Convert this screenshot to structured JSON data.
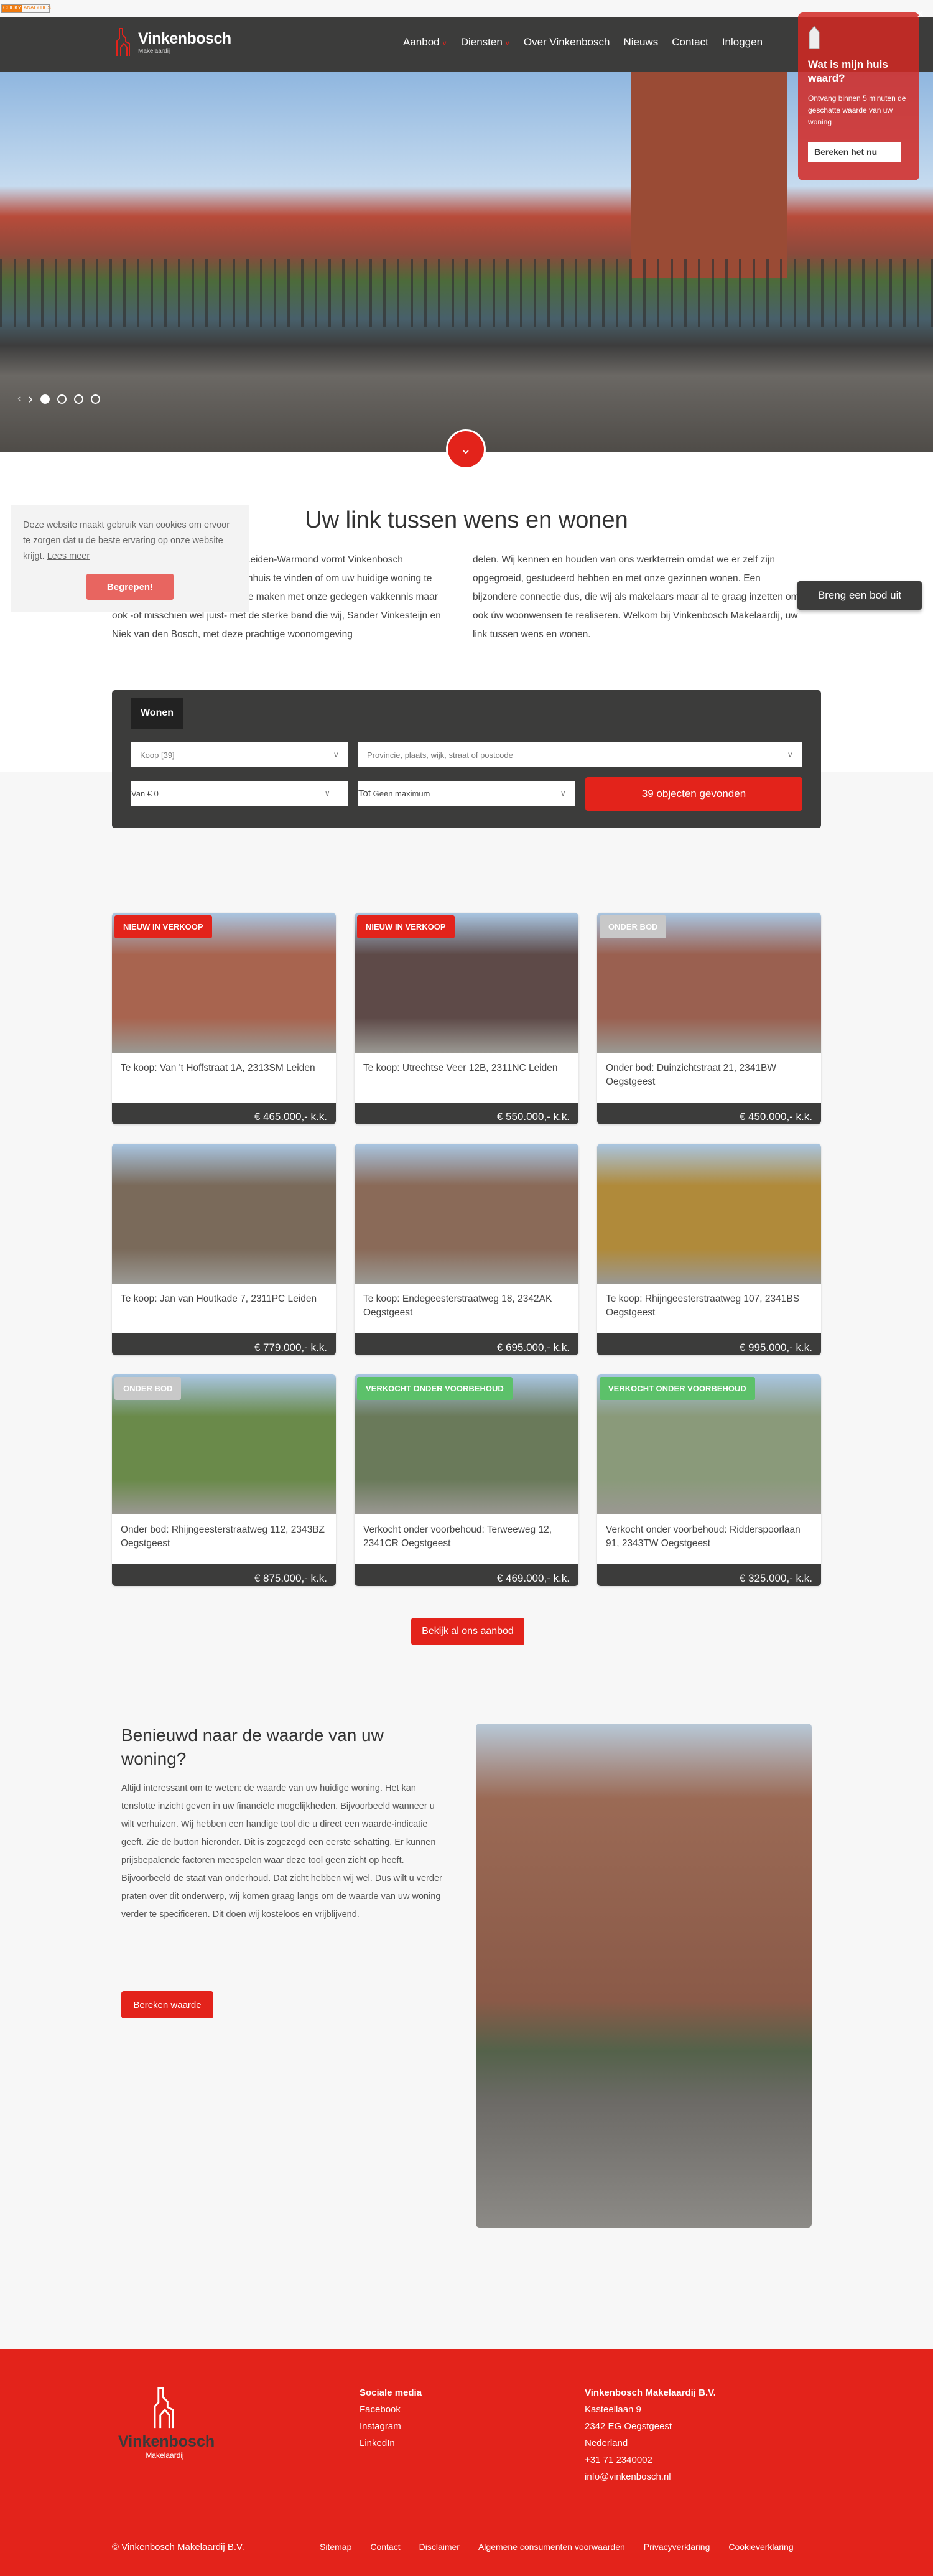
{
  "topbar": {
    "analytics_badge": [
      "CLICKY",
      "ANALYTICS"
    ]
  },
  "header": {
    "logo_name": "Vinkenbosch",
    "logo_sub": "Makelaardij",
    "nav": [
      {
        "label": "Aanbod",
        "dropdown": true
      },
      {
        "label": "Diensten",
        "dropdown": true
      },
      {
        "label": "Over Vinkenbosch"
      },
      {
        "label": "Nieuws"
      },
      {
        "label": "Contact"
      },
      {
        "label": "Inloggen"
      }
    ]
  },
  "popup": {
    "title": "Wat is mijn huis waard?",
    "text": "Ontvang binnen 5 minuten de geschatte waarde van uw woning",
    "button": "Bereken het nu",
    "close": "X"
  },
  "hero": {
    "slides": 4,
    "active_slide": 1
  },
  "intro": {
    "title": "Uw link tussen wens en wonen",
    "col1": "Binnen het gebied Oegstgeest-Leiden-Warmond vormt Vinkenbosch Makelaardij dé link om uw droomhuis te vinden of om uw huidige woning te verkopen. Dat heeft niet alleen te maken met onze gedegen vakkennis maar ook -of misschien wel juist- met de sterke band die wij, Sander Vinkesteijn en Niek van den Bosch, met deze prachtige woonomgeving",
    "col2": "delen. Wij kennen en houden van ons werkterrein omdat we er zelf zijn opgegroeid, gestudeerd hebben en met onze gezinnen wonen. Een bijzondere connectie dus, die wij als makelaars maar al te graag inzetten om ook úw woonwensen te realiseren. Welkom bij Vinkenbosch Makelaardij, uw link tussen wens en wonen.",
    "bid_button": "Breng een bod uit"
  },
  "cookie": {
    "text": "Deze website maakt gebruik van cookies om ervoor te zorgen dat u de beste ervaring op onze website krijgt.",
    "link": "Lees meer",
    "button": "Begrepen!"
  },
  "search": {
    "tab": "Wonen",
    "type": "Koop [39]",
    "location_placeholder": "Provincie, plaats, wijk, straat of postcode",
    "from_label": "Van",
    "from_value": "€ 0",
    "to_label": "Tot",
    "to_value": "Geen maximum",
    "submit": "39 objecten gevonden"
  },
  "colors": {
    "brand_red": "#e3231b",
    "dark": "#3c3c3b",
    "badge_new": "#e3231b",
    "badge_bid": "#c8c8c8",
    "badge_sold": "#5cc16a"
  },
  "listings": [
    {
      "badge": "NIEUW IN VERKOOP",
      "badge_type": "new",
      "title": "Te koop: Van 't Hoffstraat 1A, 2313SM Leiden",
      "price": "€ 465.000,- k.k."
    },
    {
      "badge": "NIEUW IN VERKOOP",
      "badge_type": "new",
      "title": "Te koop: Utrechtse Veer 12B, 2311NC Leiden",
      "price": "€ 550.000,- k.k."
    },
    {
      "badge": "ONDER BOD",
      "badge_type": "bid",
      "title": "Onder bod: Duinzichtstraat 21, 2341BW Oegstgeest",
      "price": "€ 450.000,- k.k."
    },
    {
      "badge": "",
      "badge_type": "",
      "title": "Te koop: Jan van Houtkade 7, 2311PC Leiden",
      "price": "€ 779.000,- k.k."
    },
    {
      "badge": "",
      "badge_type": "",
      "title": "Te koop: Endegeesterstraatweg 18, 2342AK Oegstgeest",
      "price": "€ 695.000,- k.k."
    },
    {
      "badge": "",
      "badge_type": "",
      "title": "Te koop: Rhijngeesterstraatweg 107, 2341BS Oegstgeest",
      "price": "€ 995.000,- k.k."
    },
    {
      "badge": "ONDER BOD",
      "badge_type": "bid",
      "title": "Onder bod: Rhijngeesterstraatweg 112, 2343BZ Oegstgeest",
      "price": "€ 875.000,- k.k."
    },
    {
      "badge": "VERKOCHT ONDER VOORBEHOUD",
      "badge_type": "sold",
      "title": "Verkocht onder voorbehoud: Terweeweg 12, 2341CR Oegstgeest",
      "price": "€ 469.000,- k.k."
    },
    {
      "badge": "VERKOCHT ONDER VOORBEHOUD",
      "badge_type": "sold",
      "title": "Verkocht onder voorbehoud: Ridderspoorlaan 91, 2343TW Oegstgeest",
      "price": "€ 325.000,- k.k."
    }
  ],
  "more_button": "Bekijk al ons aanbod",
  "valuation": {
    "title": "Benieuwd naar de waarde van uw woning?",
    "text": "Altijd interessant om te weten: de waarde van uw huidige woning. Het kan tenslotte inzicht geven in uw financiële mogelijkheden. Bijvoorbeeld wanneer u wilt verhuizen. Wij hebben een handige tool die u direct een waarde-indicatie geeft. Zie de button hieronder. Dit is zogezegd een eerste schatting. Er kunnen prijsbepalende factoren meespelen waar deze tool geen zicht op heeft. Bijvoorbeeld de staat van onderhoud. Dat zicht hebben wij wel. Dus wilt u verder praten over dit onderwerp, wij komen graag langs om de waarde van uw woning verder te specificeren. Dit doen wij kosteloos en vrijblijvend.",
    "button": "Bereken waarde"
  },
  "footer": {
    "logo_name": "Vinkenbosch",
    "logo_sub": "Makelaardij",
    "social_title": "Sociale media",
    "social": [
      "Facebook",
      "Instagram",
      "LinkedIn"
    ],
    "company": "Vinkenbosch Makelaardij B.V.",
    "address": [
      "Kasteellaan 9",
      "2342 EG Oegstgeest",
      "Nederland",
      "+31 71 2340002",
      "info@vinkenbosch.nl"
    ],
    "copyright": "© Vinkenbosch Makelaardij B.V.",
    "links": [
      "Sitemap",
      "Contact",
      "Disclaimer",
      "Algemene consumenten voorwaarden",
      "Privacyverklaring",
      "Cookieverklaring"
    ]
  }
}
